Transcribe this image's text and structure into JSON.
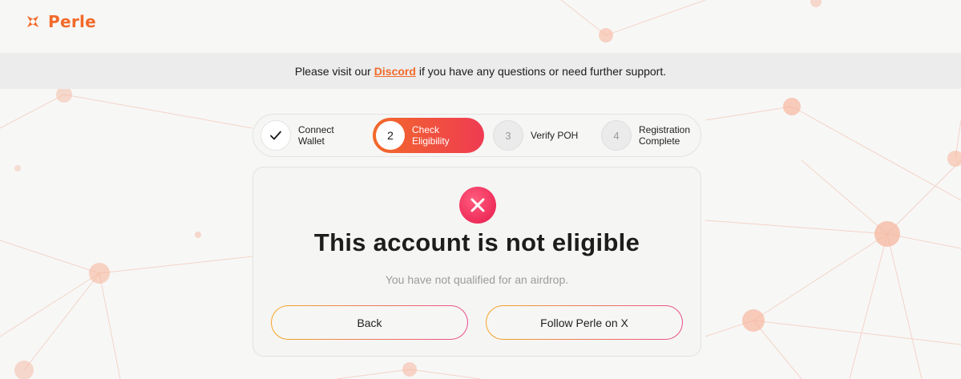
{
  "header": {
    "brand": "Perle",
    "brand_color": "#f26a2a"
  },
  "banner": {
    "prefix": "Please visit our",
    "link_label": "Discord",
    "suffix": "if you have any questions or need further support."
  },
  "stepper": {
    "steps": [
      {
        "number": "",
        "label": "Connect Wallet",
        "status": "done",
        "icon": "check-icon"
      },
      {
        "number": "2",
        "label": "Check Eligibility",
        "status": "active"
      },
      {
        "number": "3",
        "label": "Verify POH",
        "status": "pending"
      },
      {
        "number": "4",
        "label": "Registration Complete",
        "status": "pending"
      }
    ]
  },
  "result": {
    "icon": "close-icon",
    "title": "This account is not eligible",
    "subtitle": "You have not qualified for an airdrop.",
    "back_label": "Back",
    "follow_label": "Follow Perle on X"
  },
  "colors": {
    "accent_orange": "#f26a2a",
    "accent_red": "#ef3b52",
    "error": "#ee2d5a"
  }
}
